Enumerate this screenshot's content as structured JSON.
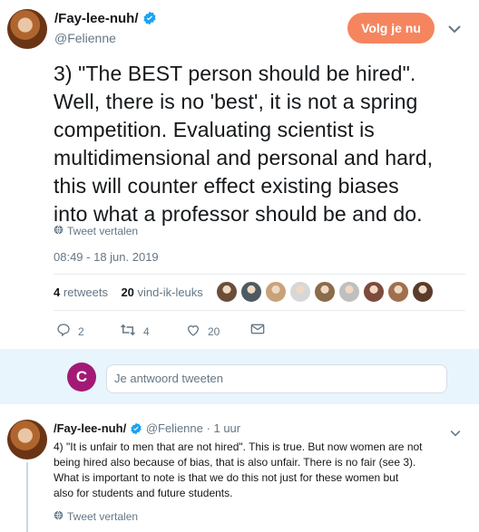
{
  "tweet": {
    "display_name": "/Fay-lee-nuh/",
    "handle": "@Felienne",
    "follow_label": "Volg je nu",
    "text_lines": [
      "3) \"The BEST person should be hired\".",
      "Well, there is no 'best', it is not a spring",
      "competition. Evaluating scientist is",
      "multidimensional and personal and hard,",
      "this will counter effect existing biases",
      "into what a professor should be and do."
    ],
    "translate_label": "Tweet vertalen",
    "timestamp": "08:49 - 18 jun. 2019",
    "retweets_count": "4",
    "retweets_label": "retweets",
    "likes_count": "20",
    "likes_label": "vind-ik-leuks",
    "liker_colors": [
      "#6b4d3a",
      "#4d5a62",
      "#c9a27a",
      "#d7d7d7",
      "#8a6b4b",
      "#bfbfbf",
      "#7d4b3c",
      "#a0704e",
      "#5a3b2a"
    ],
    "actions": {
      "replies": "2",
      "retweets": "4",
      "likes": "20"
    }
  },
  "compose": {
    "avatar_letter": "C",
    "placeholder": "Je antwoord tweeten"
  },
  "reply": {
    "display_name": "/Fay-lee-nuh/",
    "handle": "@Felienne",
    "separator": "·",
    "time": "1 uur",
    "text_lines": [
      "4) \"It is unfair to men that are not hired\". This is true. But now women are not",
      "being hired also because of bias, that is also unfair. There is no fair (see 3).",
      "What is important to note is that we do this not just for these women but",
      "also for students and future students."
    ],
    "translate_label": "Tweet vertalen"
  },
  "colors": {
    "follow_button": "#f5855f",
    "verified": "#1da1f2",
    "compose_avatar": "#a31a76"
  }
}
